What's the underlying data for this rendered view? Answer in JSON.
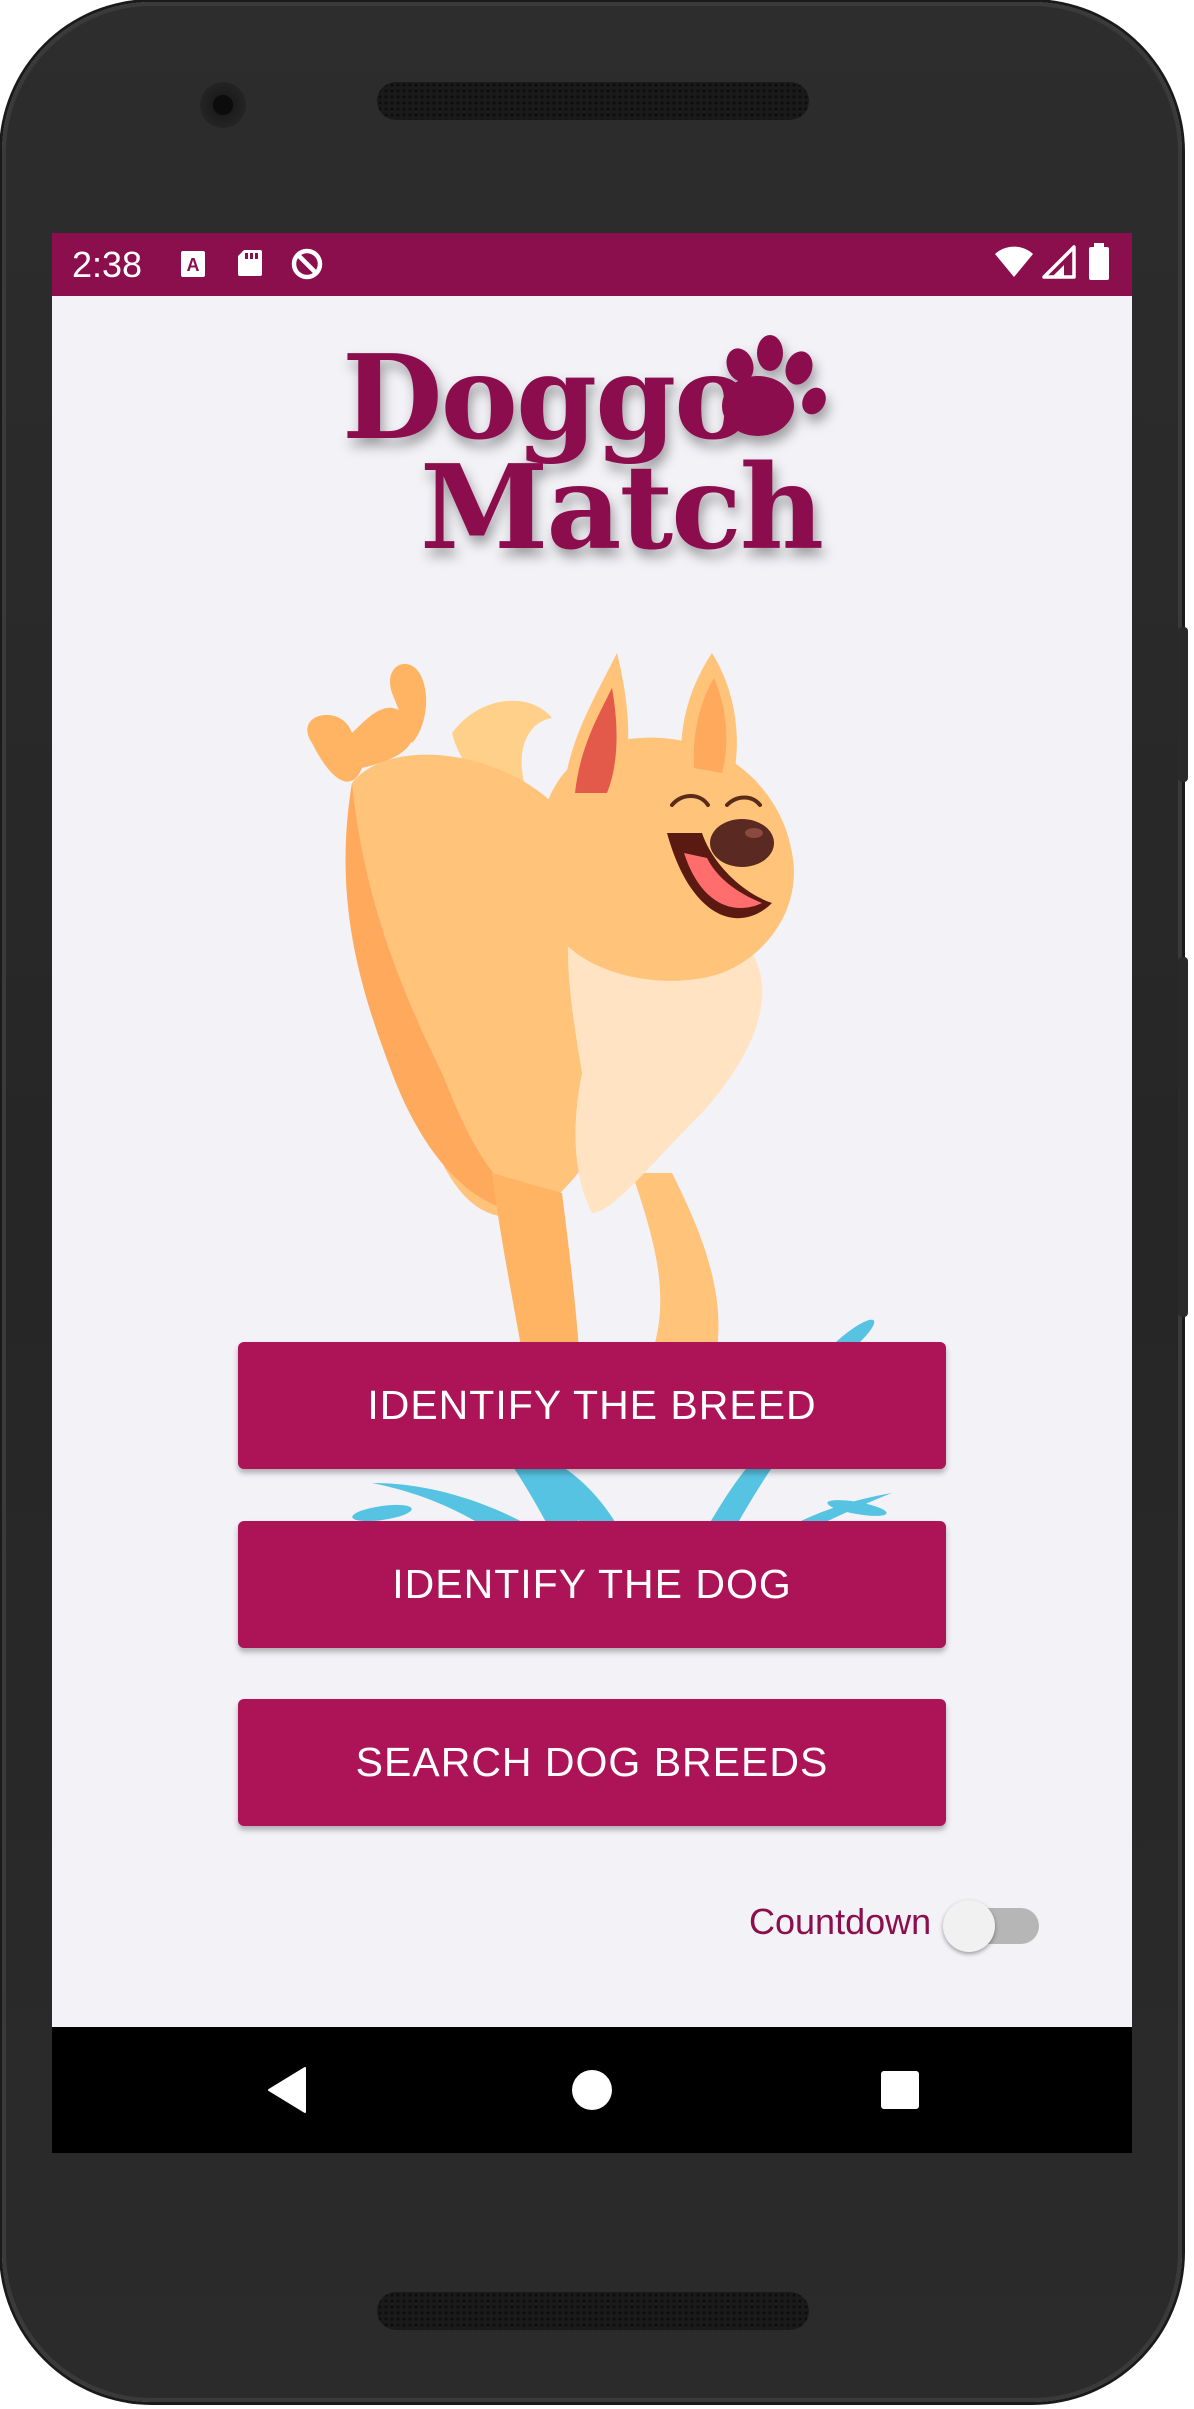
{
  "status_bar": {
    "time": "2:38",
    "background_color": "#8b0f4d",
    "left_icons": [
      "font-a-icon",
      "sd-card-icon",
      "data-saver-icon"
    ],
    "right_icons": [
      "wifi-icon",
      "cell-signal-icon",
      "battery-icon"
    ]
  },
  "app": {
    "logo_line1": "Doggo",
    "logo_line2": "Match",
    "logo_color": "#8b0f4d",
    "accent_color": "#ad1457",
    "background_color": "#f2f2f7"
  },
  "buttons": {
    "identify_breed": "IDENTIFY THE BREED",
    "identify_dog": "IDENTIFY THE DOG",
    "search_breeds": "SEARCH DOG BREEDS"
  },
  "countdown": {
    "label": "Countdown",
    "enabled": false
  },
  "nav_bar": {
    "icons": [
      "back-icon",
      "home-icon",
      "recents-icon"
    ]
  }
}
